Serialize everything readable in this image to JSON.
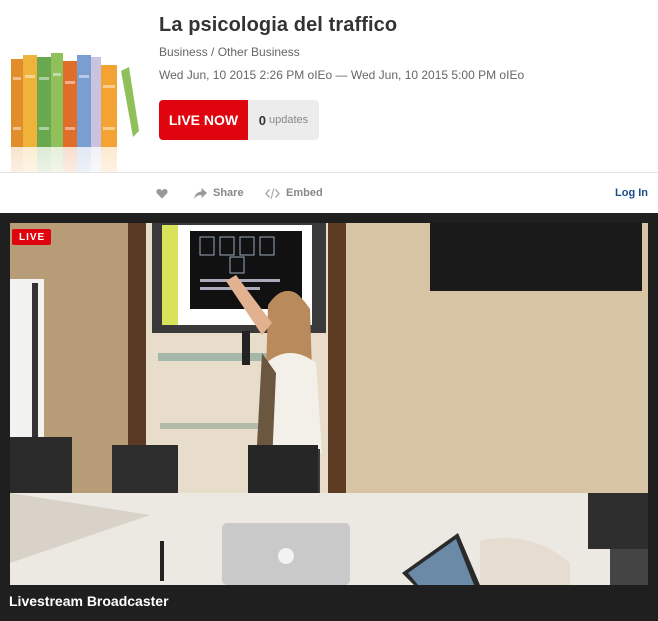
{
  "event": {
    "title": "La psicologia del traffico",
    "category": "Business / Other Business",
    "dates": "Wed Jun, 10 2015 2:26 PM oIEo — Wed Jun, 10 2015 5:00 PM oIEo",
    "live_label": "LIVE NOW",
    "updates_count": "0",
    "updates_label": "updates"
  },
  "toolbar": {
    "share_label": "Share",
    "embed_label": "Embed",
    "login_label": "Log In"
  },
  "player": {
    "live_badge": "LIVE",
    "broadcaster": "Livestream Broadcaster"
  },
  "colors": {
    "live_red": "#e0040f",
    "link_blue": "#1a4f8b",
    "player_bg": "#1f1f1f"
  },
  "icons": {
    "thumbnail": "books-icon",
    "like": "heart-icon",
    "share": "share-arrow-icon",
    "embed": "code-icon"
  }
}
